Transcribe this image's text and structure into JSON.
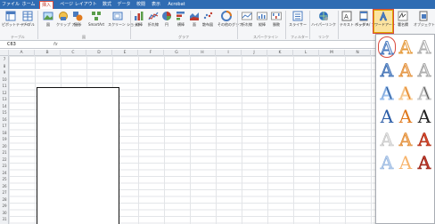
{
  "menu": {
    "tabs": [
      {
        "label": "ファイル",
        "active": false
      },
      {
        "label": "ホーム",
        "active": false
      },
      {
        "label": "挿入",
        "active": true
      },
      {
        "label": "ページ レイアウト",
        "active": false
      },
      {
        "label": "数式",
        "active": false
      },
      {
        "label": "データ",
        "active": false
      },
      {
        "label": "校閲",
        "active": false
      },
      {
        "label": "表示",
        "active": false
      },
      {
        "label": "Acrobat",
        "active": false
      }
    ]
  },
  "ribbon": {
    "buttons": [
      {
        "label": "ピボットテーブル",
        "icon": "pivot-table-icon"
      },
      {
        "label": "テーブル",
        "icon": "table-icon"
      },
      {
        "label": "図",
        "icon": "picture-icon"
      },
      {
        "label": "クリップ アート",
        "icon": "clip-art-icon"
      },
      {
        "label": "図形",
        "icon": "shapes-icon"
      },
      {
        "label": "SmartArt",
        "icon": "smartart-icon"
      },
      {
        "label": "スクリーン ショット",
        "icon": "screenshot-icon"
      },
      {
        "label": "縦棒",
        "icon": "column-chart-icon"
      },
      {
        "label": "折れ線",
        "icon": "line-chart-icon"
      },
      {
        "label": "円",
        "icon": "pie-chart-icon"
      },
      {
        "label": "横棒",
        "icon": "bar-chart-icon"
      },
      {
        "label": "面",
        "icon": "area-chart-icon"
      },
      {
        "label": "散布図",
        "icon": "scatter-chart-icon"
      },
      {
        "label": "その他のグラフ",
        "icon": "other-charts-icon"
      },
      {
        "label": "折れ線",
        "icon": "sparkline-line-icon"
      },
      {
        "label": "縦棒",
        "icon": "sparkline-column-icon"
      },
      {
        "label": "勝敗",
        "icon": "sparkline-winloss-icon"
      },
      {
        "label": "スライサー",
        "icon": "slicer-icon"
      },
      {
        "label": "ハイパーリンク",
        "icon": "hyperlink-icon"
      },
      {
        "label": "テキスト ボックス",
        "icon": "text-box-icon"
      },
      {
        "label": "ヘッダー/ フッター",
        "icon": "header-footer-icon"
      },
      {
        "label": "ワードアート",
        "icon": "wordart-icon"
      },
      {
        "label": "署名欄",
        "icon": "signature-line-icon"
      },
      {
        "label": "オブジェクト",
        "icon": "object-icon"
      }
    ],
    "groups": [
      {
        "label": "テーブル"
      },
      {
        "label": "図"
      },
      {
        "label": "グラフ"
      },
      {
        "label": "スパークライン"
      },
      {
        "label": "フィルター"
      },
      {
        "label": "リンク"
      }
    ]
  },
  "formula_bar": {
    "name_box": "C63",
    "fx_label": "fx",
    "value": ""
  },
  "columns": [
    "A",
    "B",
    "C",
    "D",
    "E",
    "F",
    "G",
    "H",
    "I",
    "J",
    "K",
    "L",
    "M",
    "N"
  ],
  "rows": [
    "7",
    "8",
    "9",
    "10",
    "11",
    "12",
    "13",
    "14",
    "15",
    "16",
    "17",
    "18",
    "19",
    "20",
    "21",
    "22",
    "23",
    "24",
    "25",
    "26",
    "27",
    "28",
    "29",
    "30",
    "31"
  ],
  "wordart_gallery": {
    "items": [
      {
        "char": "A",
        "style": "outline-blue",
        "color": "#ffffff",
        "stroke": "#4a7bbf",
        "selected": true
      },
      {
        "char": "A",
        "style": "outline-orange-light",
        "color": "#ffffff",
        "stroke": "#e59b3d",
        "selected": false
      },
      {
        "char": "A",
        "style": "outline-gray-light",
        "color": "#ffffff",
        "stroke": "#b0b0b0",
        "selected": false
      },
      {
        "char": "A",
        "style": "gradient-blue",
        "color": "#7fa6d8",
        "stroke": "#3d6cb0",
        "selected": false
      },
      {
        "char": "A",
        "style": "gradient-orange",
        "color": "#f4c79a",
        "stroke": "#e08a30",
        "selected": false
      },
      {
        "char": "A",
        "style": "gradient-gray",
        "color": "#d9d9d9",
        "stroke": "#a0a0a0",
        "selected": false
      },
      {
        "char": "A",
        "style": "fill-navy-outline",
        "color": "#1f4e8c",
        "stroke": "#9cc0ee",
        "selected": false
      },
      {
        "char": "A",
        "style": "fill-orange-outline",
        "color": "#e07a1f",
        "stroke": "#f9d19c",
        "selected": false
      },
      {
        "char": "A",
        "style": "fill-dark-gray",
        "color": "#555555",
        "stroke": "#cccccc",
        "selected": false
      },
      {
        "char": "A",
        "style": "solid-blue",
        "color": "#2e5fa8",
        "stroke": "#2e5fa8",
        "selected": false
      },
      {
        "char": "A",
        "style": "solid-orange",
        "color": "#e07a1f",
        "stroke": "#e07a1f",
        "selected": false
      },
      {
        "char": "A",
        "style": "solid-black",
        "color": "#222222",
        "stroke": "#222222",
        "selected": false
      },
      {
        "char": "A",
        "style": "pale-gray",
        "color": "#e6e6e6",
        "stroke": "#bdbdbd",
        "selected": false
      },
      {
        "char": "A",
        "style": "orange-shadow",
        "color": "#f4b26b",
        "stroke": "#d9822b",
        "selected": false
      },
      {
        "char": "A",
        "style": "red-gradient",
        "color": "#d9472b",
        "stroke": "#a52a14",
        "selected": false
      },
      {
        "char": "A",
        "style": "pale-blue",
        "color": "#bcd2ee",
        "stroke": "#8fb0dc",
        "selected": false
      },
      {
        "char": "A",
        "style": "soft-orange",
        "color": "#f7b56e",
        "stroke": "#f7b56e",
        "selected": false
      },
      {
        "char": "A",
        "style": "bold-red",
        "color": "#c0392b",
        "stroke": "#8e1e12",
        "selected": false
      }
    ]
  }
}
